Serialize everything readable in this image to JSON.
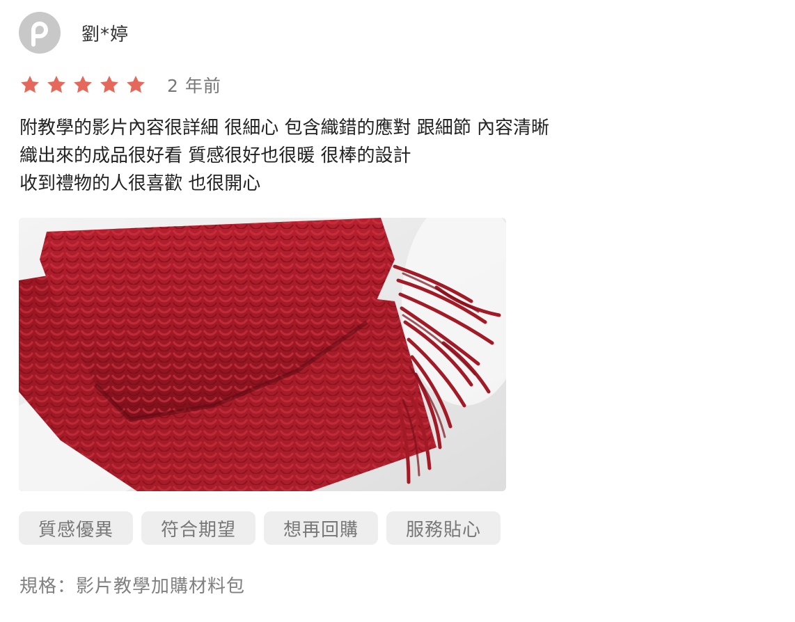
{
  "review": {
    "avatar_icon": "pinkoi-p-logo-icon",
    "user_name": "劉*婷",
    "rating": 5,
    "rating_max": 5,
    "star_color": "#e5685b",
    "time_ago": "2 年前",
    "comment_lines": [
      "附教學的影片內容很詳細 很細心 包含織錯的應對 跟細節 內容清晰",
      "織出來的成品很好看 質感很好也很暖 很棒的設計",
      "收到禮物的人很喜歡 也很開心"
    ],
    "tags": [
      "質感優異",
      "符合期望",
      "想再回購",
      "服務貼心"
    ],
    "spec": "規格：影片教學加購材料包"
  }
}
